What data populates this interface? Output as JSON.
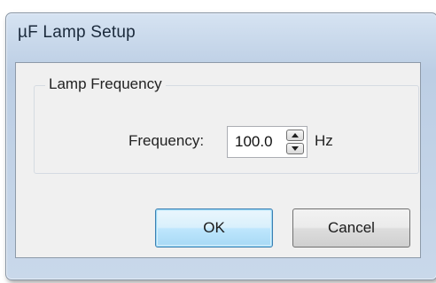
{
  "window": {
    "title": "µF Lamp Setup"
  },
  "group": {
    "label": "Lamp Frequency"
  },
  "frequency": {
    "label": "Frequency:",
    "value": "100.0",
    "unit": "Hz"
  },
  "buttons": {
    "ok": "OK",
    "cancel": "Cancel"
  },
  "colors": {
    "accent": "#3c7fb1",
    "frame": "#c7d7ea",
    "client_bg": "#f0f0f0"
  },
  "icons": {
    "spin_up": "triangle-up-icon",
    "spin_down": "triangle-down-icon"
  }
}
